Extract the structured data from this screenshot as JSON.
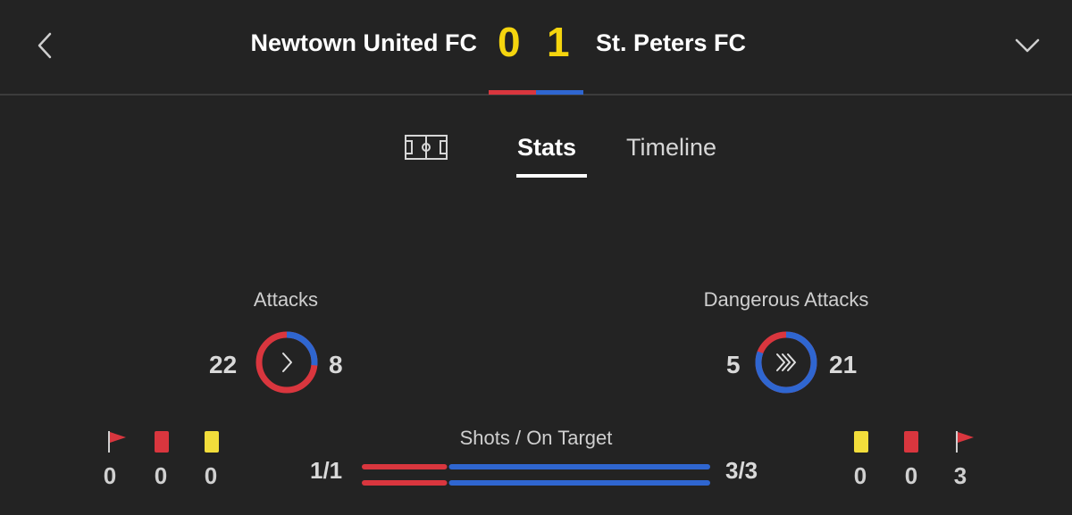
{
  "header": {
    "home_team": "Newtown United FC",
    "away_team": "St. Peters FC",
    "home_score": "0",
    "away_score": "1",
    "back_icon": "chevron-left-icon",
    "expand_icon": "chevron-down-icon"
  },
  "tabs": {
    "pitch_icon": "pitch-icon",
    "stats": "Stats",
    "timeline": "Timeline",
    "active": "Stats"
  },
  "colors": {
    "home": "#d9363e",
    "away": "#2f66d0",
    "score": "#f5d50e",
    "yellow_card": "#f2dd3b",
    "red_card": "#d9363e"
  },
  "stats": {
    "attacks": {
      "title": "Attacks",
      "home": "22",
      "away": "8",
      "icon": "chevron-right-icon"
    },
    "dangerous_attacks": {
      "title": "Dangerous Attacks",
      "home": "5",
      "away": "21",
      "icon": "triple-chevron-icon"
    },
    "shots": {
      "title": "Shots / On Target",
      "home": "1/1",
      "away": "3/3",
      "home_fraction": 0.25
    },
    "home_corners": "0",
    "home_red_cards": "0",
    "home_yellow_cards": "0",
    "away_yellow_cards": "0",
    "away_red_cards": "0",
    "away_corners": "3"
  }
}
